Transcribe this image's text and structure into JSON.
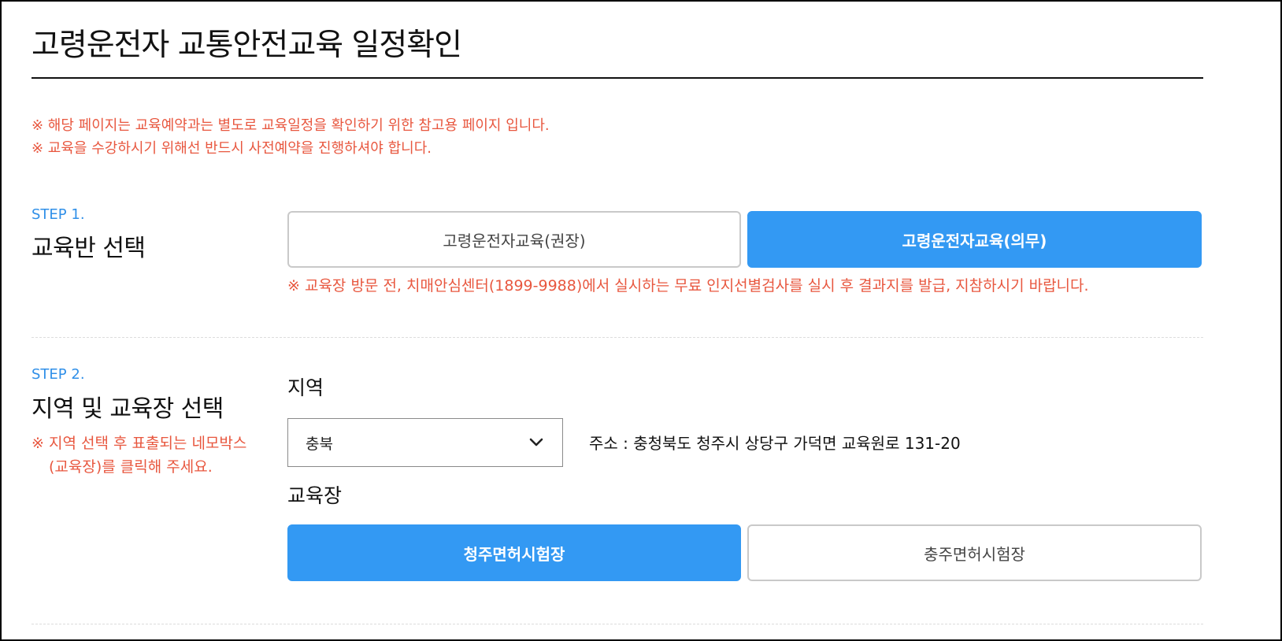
{
  "page": {
    "title": "고령운전자 교통안전교육 일정확인"
  },
  "notices": [
    "※ 해당 페이지는 교육예약과는 별도로 교육일정을 확인하기 위한 참고용 페이지 입니다.",
    "※ 교육을 수강하시기 위해선 반드시 사전예약을 진행하셔야 합니다."
  ],
  "step1": {
    "tag": "STEP 1.",
    "title": "교육반 선택",
    "options": [
      {
        "label": "고령운전자교육(권장)",
        "selected": false
      },
      {
        "label": "고령운전자교육(의무)",
        "selected": true
      }
    ],
    "warning": "※ 교육장 방문 전, 치매안심센터(1899-9988)에서 실시하는 무료 인지선별검사를 실시 후 결과지를 발급, 지참하시기 바랍니다."
  },
  "step2": {
    "tag": "STEP 2.",
    "title": "지역 및 교육장 선택",
    "note_line1": "※ 지역 선택 후 표출되는 네모박스",
    "note_line2": "(교육장)를 클릭해 주세요.",
    "region_label": "지역",
    "region_value": "충북",
    "address": "주소 : 충청북도 청주시 상당구 가덕면 교육원로 131-20",
    "center_label": "교육장",
    "centers": [
      {
        "label": "청주면허시험장",
        "selected": true
      },
      {
        "label": "충주면허시험장",
        "selected": false
      }
    ]
  },
  "colors": {
    "accent": "#3399f3",
    "warning": "#e8573f",
    "step_tag": "#2f8fe8"
  },
  "icons": {
    "select_arrow": "chevron-down-icon"
  }
}
